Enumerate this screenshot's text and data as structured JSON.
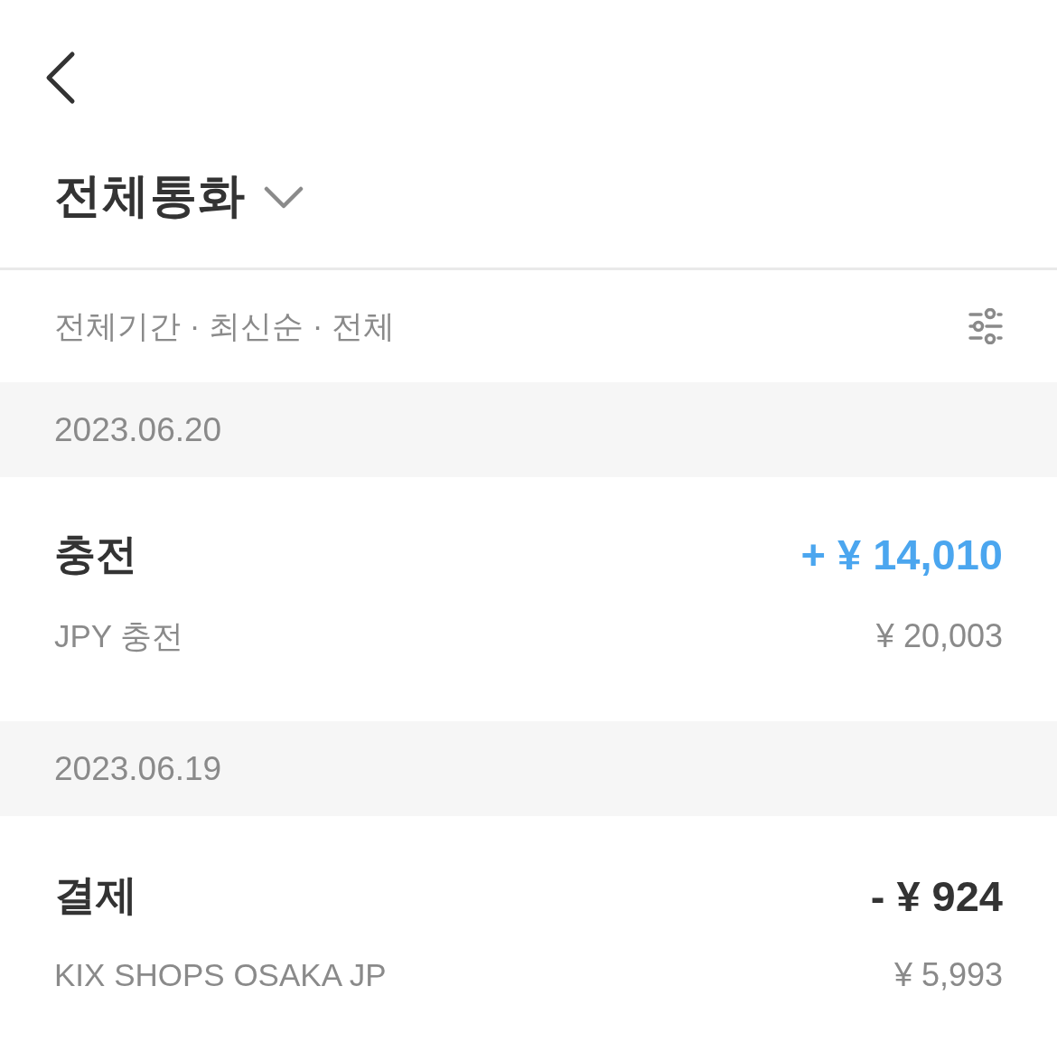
{
  "header": {
    "title": "전체통화"
  },
  "filter": {
    "summary": "전체기간 · 최신순 · 전체"
  },
  "groups": [
    {
      "date": "2023.06.20",
      "transactions": [
        {
          "title": "충전",
          "kind": "credit",
          "amount": "+ ¥ 14,010",
          "description": "JPY 충전",
          "original_amount": "¥ 20,003"
        }
      ]
    },
    {
      "date": "2023.06.19",
      "transactions": [
        {
          "title": "결제",
          "kind": "debit",
          "amount": "- ¥ 924",
          "description": "KIX SHOPS OSAKA JP",
          "original_amount": "¥ 5,993"
        }
      ]
    }
  ]
}
